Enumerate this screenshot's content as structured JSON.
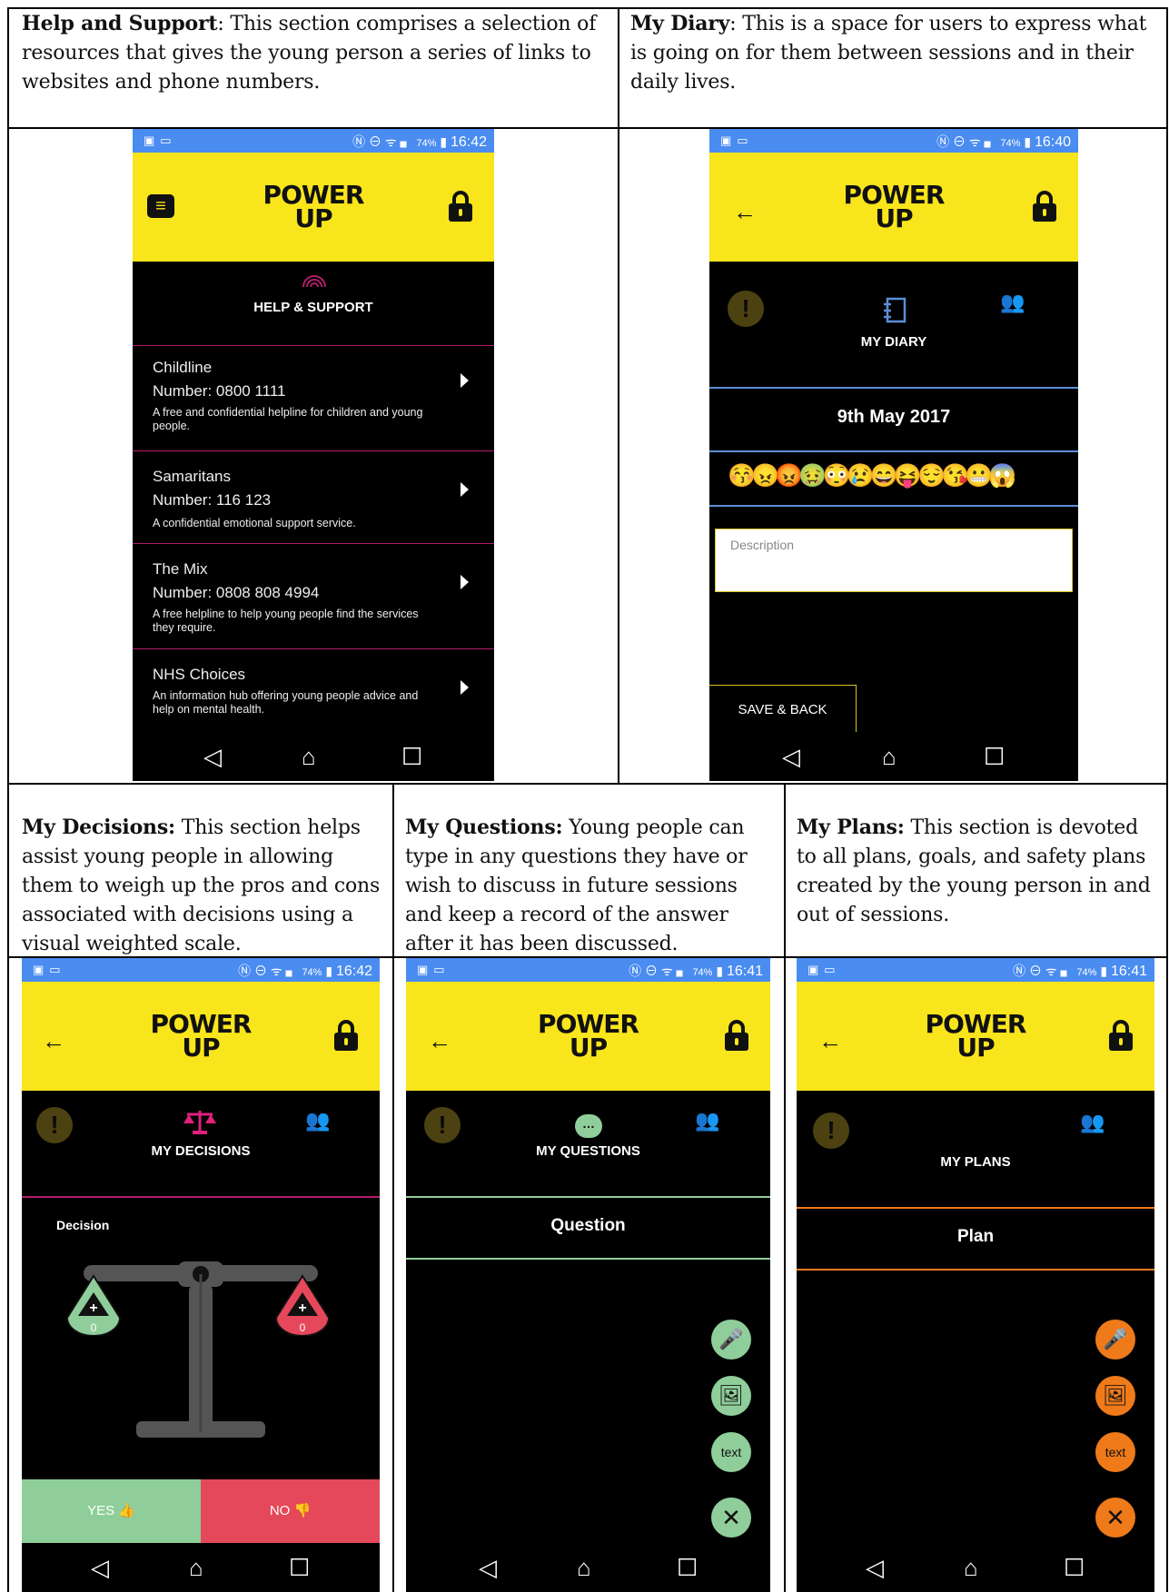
{
  "captions": {
    "help": {
      "bold": "Help and Support",
      "text": ": This section comprises a selection of resources that gives the young person a series of links to websites and phone numbers."
    },
    "diary": {
      "bold": "My Diary",
      "text": ": This is a space for users to express what is going on for them between sessions and in their daily lives."
    },
    "decisions": {
      "bold": "My Decisions:",
      "text": " This section helps assist young people in allowing them to weigh up the pros and cons associated with decisions using a visual weighted scale."
    },
    "questions": {
      "bold": "My Questions:",
      "text": " Young people can type in any questions they have or wish to discuss in future sessions and keep a record of the answer after it has been discussed."
    },
    "plans": {
      "bold": "My Plans:",
      "text": " This section is devoted to all plans, goals, and safety plans created by the young person in and out of sessions."
    }
  },
  "app": {
    "logo_line1": "POWER",
    "logo_line2": "UP",
    "battery": "74%",
    "colors": {
      "yellow": "#f9e51c",
      "statusbar": "#4a8cf0",
      "magenta": "#b01d6a",
      "blue": "#5b8fd6",
      "green": "#8fce9a",
      "red": "#e4485a",
      "orange": "#ee7a1a"
    }
  },
  "help_screen": {
    "time": "16:42",
    "title": "HELP & SUPPORT",
    "items": [
      {
        "name": "Childline",
        "number": "Number: 0800 1111",
        "desc": "A free and confidential helpline for children and young people."
      },
      {
        "name": "Samaritans",
        "number": "Number: 116 123",
        "desc": "A confidential emotional support service."
      },
      {
        "name": "The Mix",
        "number": "Number: 0808 808 4994",
        "desc": "A free helpline to help young people find the services they require."
      },
      {
        "name": "NHS Choices",
        "number": "",
        "desc": "An information hub offering young people advice and help on mental health."
      }
    ]
  },
  "diary_screen": {
    "time": "16:40",
    "title": "MY DIARY",
    "date": "9th May 2017",
    "description_placeholder": "Description",
    "save_label": "SAVE & BACK"
  },
  "decisions_screen": {
    "time": "16:42",
    "title": "MY DECISIONS",
    "label": "Decision",
    "left_count": "0",
    "right_count": "0",
    "yes_label": "YES",
    "no_label": "NO"
  },
  "questions_screen": {
    "time": "16:41",
    "title": "MY QUESTIONS",
    "header": "Question",
    "text_label": "text"
  },
  "plans_screen": {
    "time": "16:41",
    "title": "MY PLANS",
    "header": "Plan",
    "text_label": "text"
  }
}
